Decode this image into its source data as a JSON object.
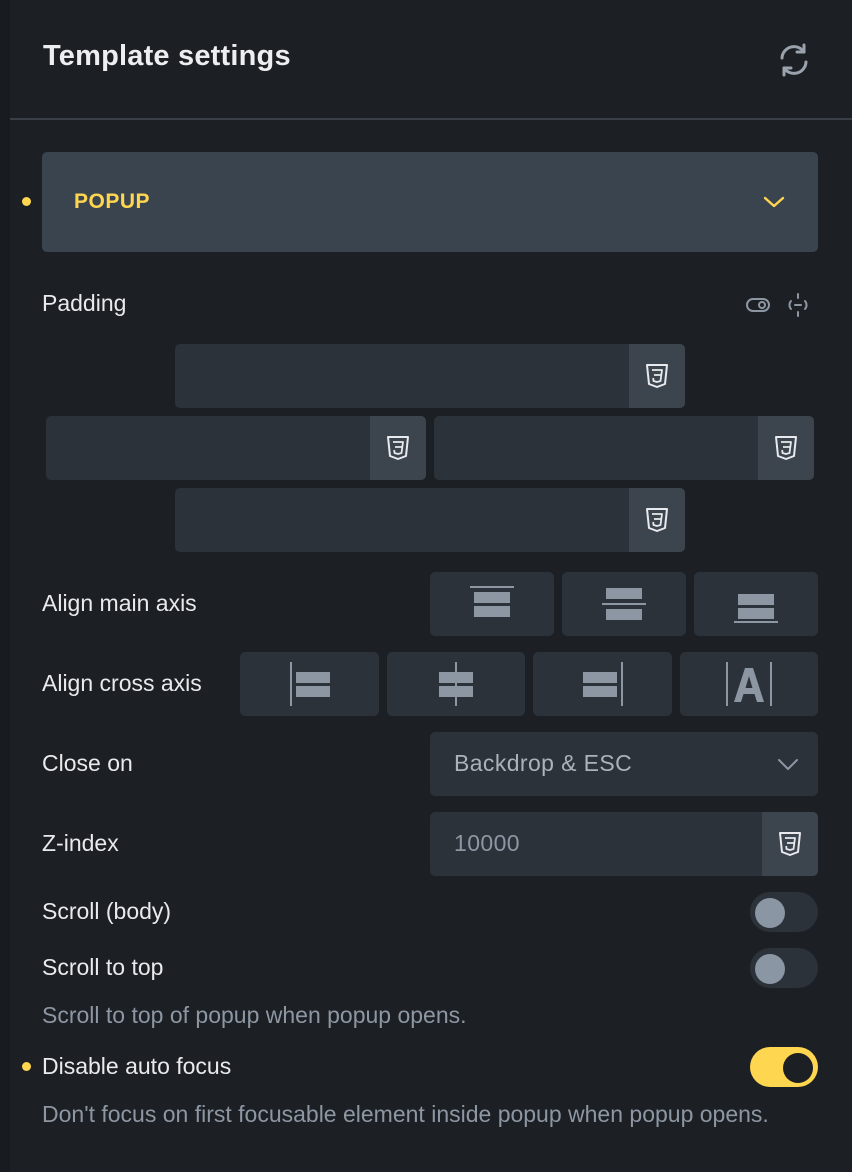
{
  "header": {
    "title": "Template settings",
    "refresh_icon": "refresh-icon"
  },
  "accordion": {
    "title": "POPUP",
    "icon": "chevron-down-icon",
    "modified": true
  },
  "padding": {
    "label": "Padding",
    "icons": [
      "toggle-visibility-icon",
      "link-icon"
    ],
    "top": {
      "value": "",
      "unit_icon": "css3-icon"
    },
    "left": {
      "value": "",
      "unit_icon": "css3-icon"
    },
    "right": {
      "value": "",
      "unit_icon": "css3-icon"
    },
    "bottom": {
      "value": "",
      "unit_icon": "css3-icon"
    }
  },
  "align_main_axis": {
    "label": "Align main axis",
    "options": [
      "align-top-icon",
      "align-center-vertical-icon",
      "align-bottom-icon"
    ]
  },
  "align_cross_axis": {
    "label": "Align cross axis",
    "options": [
      "align-left-icon",
      "align-center-horizontal-icon",
      "align-right-icon",
      "stretch-icon"
    ]
  },
  "close_on": {
    "label": "Close on",
    "value": "Backdrop & ESC"
  },
  "z_index": {
    "label": "Z-index",
    "placeholder": "10000"
  },
  "scroll_body": {
    "label": "Scroll (body)",
    "checked": false
  },
  "scroll_to_top": {
    "label": "Scroll to top",
    "checked": false,
    "description": "Scroll to top of popup when popup opens."
  },
  "disable_auto_focus": {
    "label": "Disable auto focus",
    "checked": true,
    "modified": true,
    "description": "Don't focus on first focusable element inside popup when popup opens."
  },
  "colors": {
    "accent": "#ffd64f",
    "panel": "#1c1f23",
    "field": "#2c323a"
  }
}
